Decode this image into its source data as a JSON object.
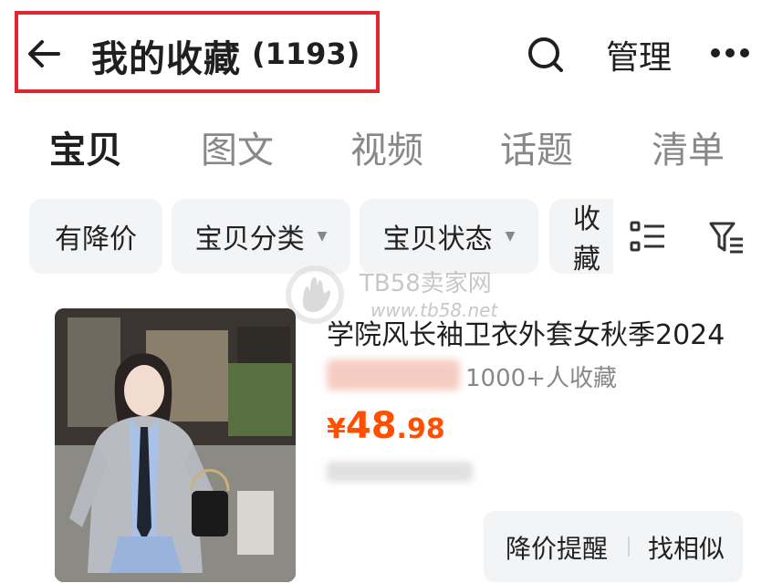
{
  "header": {
    "title": "我的收藏",
    "count": "(1193)",
    "manage_label": "管理",
    "highlight_color": "#e0262e",
    "icons": [
      "back-arrow-icon",
      "search-icon",
      "more-icon"
    ]
  },
  "tabs": [
    {
      "label": "宝贝",
      "active": true
    },
    {
      "label": "图文",
      "active": false
    },
    {
      "label": "视频",
      "active": false
    },
    {
      "label": "话题",
      "active": false
    },
    {
      "label": "清单",
      "active": false
    }
  ],
  "filters": [
    {
      "label": "有降价",
      "dropdown": false
    },
    {
      "label": "宝贝分类",
      "dropdown": true
    },
    {
      "label": "宝贝状态",
      "dropdown": true
    },
    {
      "label": "收藏",
      "dropdown": false
    }
  ],
  "filter_icons": [
    "list-view-icon",
    "filter-icon"
  ],
  "watermark": {
    "name": "TB58卖家网",
    "url": "www.tb58.net"
  },
  "product": {
    "title": "学院风长袖卫衣外套女秋季2024",
    "favorites": "1000+人收藏",
    "price_currency": "¥",
    "price_int": "48",
    "price_dec": ".98",
    "price_color": "#ff4f00",
    "actions": {
      "price_alert": "降价提醒",
      "find_similar": "找相似"
    }
  }
}
